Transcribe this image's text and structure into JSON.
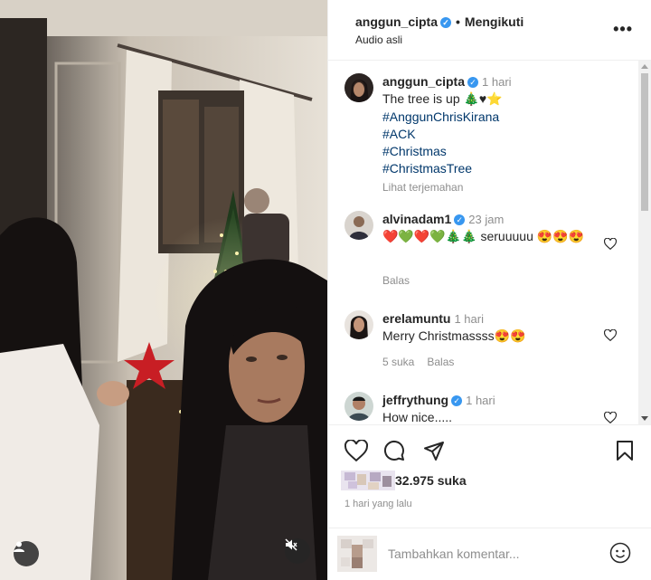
{
  "header": {
    "username": "anggun_cipta",
    "separator": "•",
    "follow_status": "Mengikuti",
    "subtitle": "Audio asli",
    "more": "•••"
  },
  "caption": {
    "username": "anggun_cipta",
    "time": "1 hari",
    "text": "The tree is up 🎄♥⭐",
    "hashtags": [
      "#AnggunChrisKirana",
      "#ACK",
      "#Christmas",
      "#ChristmasTree"
    ],
    "translate": "Lihat terjemahan"
  },
  "comments": [
    {
      "username": "alvinadam1",
      "verified": true,
      "time": "23 jam",
      "text": "❤️💚❤️💚🎄🎄 seruuuuu 😍😍😍",
      "likes": "",
      "reply": "Balas"
    },
    {
      "username": "erelamuntu",
      "verified": false,
      "time": "1 hari",
      "text": "Merry Christmassss😍😍",
      "likes": "5 suka",
      "reply": "Balas"
    },
    {
      "username": "jeffrythung",
      "verified": true,
      "time": "1 hari",
      "text": "How nice.....",
      "likes": "",
      "reply": ""
    }
  ],
  "stats": {
    "likes": "32.975 suka",
    "posted": "1 hari yang lalu"
  },
  "add_comment": {
    "placeholder": "Tambahkan komentar..."
  },
  "icons": [
    "heart-icon",
    "comment-icon",
    "share-icon",
    "bookmark-icon",
    "emoji-icon",
    "user-icon",
    "mute-icon",
    "verified-icon",
    "more-icon"
  ],
  "colors": {
    "verified": "#3897f0",
    "hashtag": "#00376b",
    "muted_text": "#8e8e8e",
    "text": "#262626"
  }
}
